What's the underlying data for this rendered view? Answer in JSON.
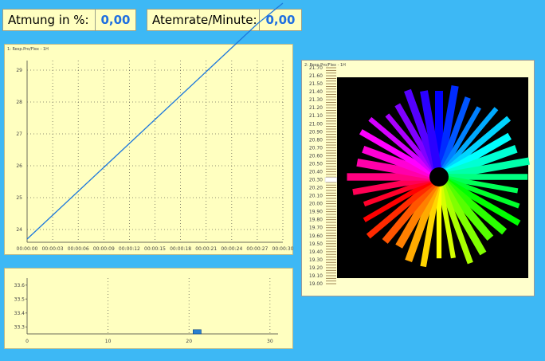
{
  "readouts": {
    "breathing_label": "Atmung in %:",
    "breathing_value": "0,00",
    "rate_label": "Atemrate/Minute:",
    "rate_value": "0,00"
  },
  "line_chart": {
    "title": "1: Resp.Pro/Flex - 1H",
    "y_ticks": [
      "29",
      "28",
      "27",
      "26",
      "25",
      "24"
    ],
    "x_ticks": [
      "00:00:00",
      "00:00:03",
      "00:00:06",
      "00:00:09",
      "00:00:12",
      "00:00:15",
      "00:00:18",
      "00:00:21",
      "00:00:24",
      "00:00:27",
      "00:00:30"
    ]
  },
  "hist_chart": {
    "y_ticks": [
      "33.6",
      "33.5",
      "33.4",
      "33.3"
    ],
    "x_ticks": [
      "0",
      "10",
      "20",
      "30"
    ]
  },
  "wheel_panel": {
    "title": "2: Resp.Pro/Flex - 1H",
    "scale_ticks": [
      "21.70",
      "21.60",
      "21.50",
      "21.40",
      "21.30",
      "21.20",
      "21.10",
      "21.00",
      "20.90",
      "20.80",
      "20.70",
      "20.60",
      "20.50",
      "20.40",
      "20.30",
      "20.20",
      "20.10",
      "20.00",
      "19.90",
      "19.80",
      "19.70",
      "19.60",
      "19.50",
      "19.40",
      "19.30",
      "19.20",
      "19.10",
      "19.00"
    ],
    "marker_value": 20.3
  },
  "chart_data": [
    {
      "type": "line",
      "title": "",
      "x": [
        "00:00:00",
        "00:00:03",
        "00:00:06",
        "00:00:09",
        "00:00:12",
        "00:00:15",
        "00:00:18",
        "00:00:21",
        "00:00:24",
        "00:00:27",
        "00:00:30"
      ],
      "series": [
        {
          "values": [
            23.7,
            24.45,
            25.2,
            25.95,
            26.7,
            27.45,
            28.2,
            28.95,
            29.7,
            30.45,
            31.1
          ]
        }
      ],
      "ylim": [
        23.6,
        29.3
      ],
      "grid": true,
      "color": "#1e78dc"
    },
    {
      "type": "bar",
      "x_range": [
        0,
        31
      ],
      "ylim": [
        33.25,
        33.65
      ],
      "bars": [
        {
          "x": 20.5,
          "width": 1,
          "value": 33.28
        }
      ],
      "color": "#2a7fd0",
      "grid": true
    }
  ]
}
